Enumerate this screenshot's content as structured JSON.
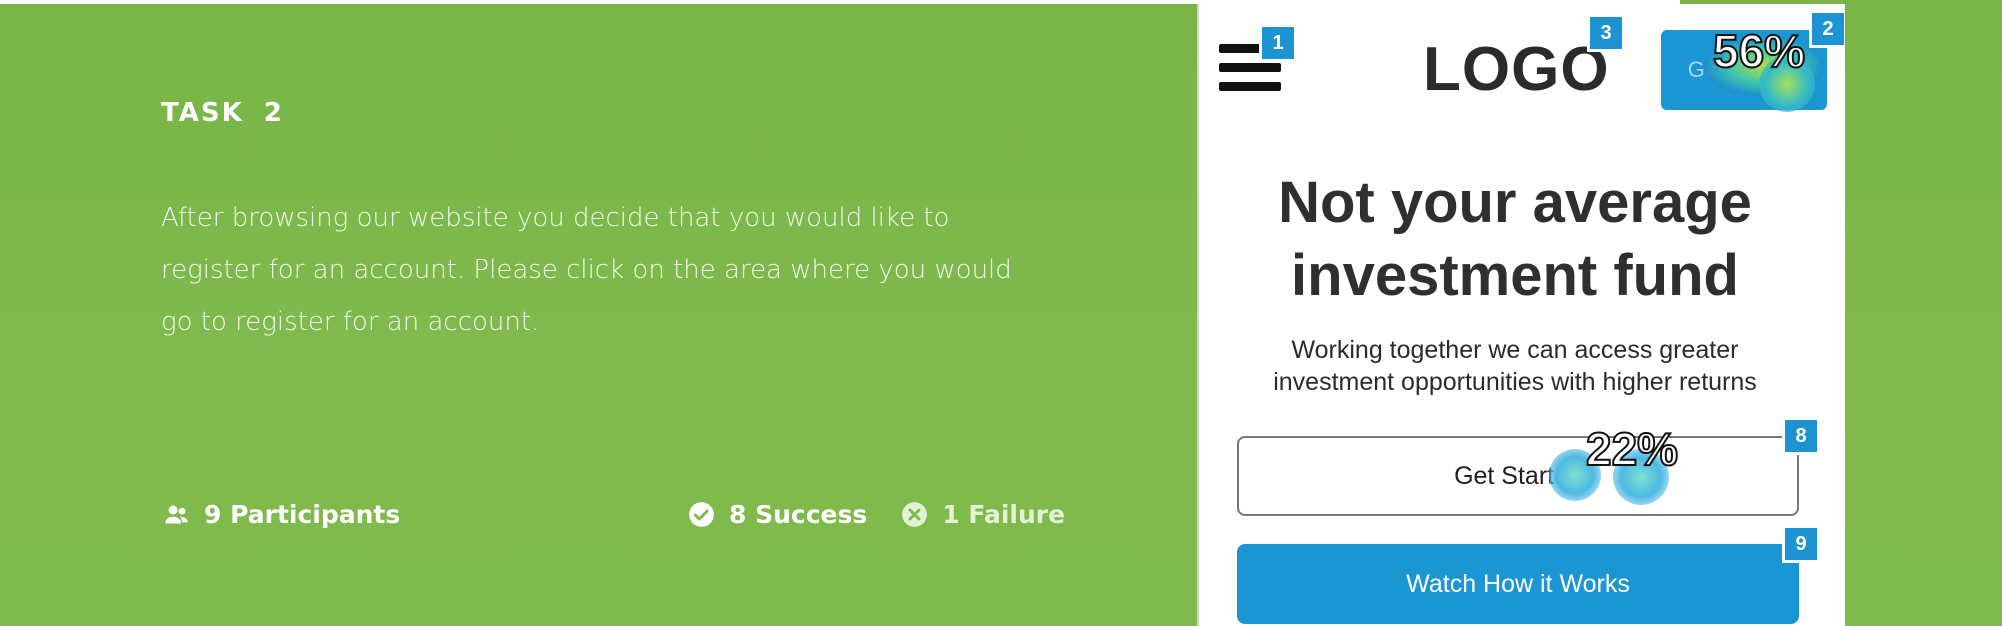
{
  "task": {
    "label": "TASK",
    "number": "2",
    "description": "After browsing our website you decide that you would like to register for an account. Please click on the area where you would go to register for an account."
  },
  "stats": {
    "participants": "9 Participants",
    "success": "8 Success",
    "failure": "1 Failure"
  },
  "preview": {
    "logo": "LOGO",
    "top_cta": "Get Started",
    "headline_line1": "Not your average",
    "headline_line2": "investment fund",
    "subhead_line1": "Working together we can access greater",
    "subhead_line2": "investment opportunities with higher returns",
    "primary_outline": "Get Started",
    "secondary": "Watch How it Works",
    "markers": [
      "1",
      "3",
      "2",
      "8",
      "9"
    ],
    "heatmap_labels": {
      "top_cta": "56%",
      "get_started": "22%"
    }
  },
  "colors": {
    "background": "#7fb94b",
    "accent_blue": "#1a96d2",
    "marker_blue": "#1e93d1",
    "text_dark": "#2f2f2f"
  },
  "icons": [
    "participants-icon",
    "check-circle-icon",
    "x-circle-icon",
    "hamburger-menu-icon"
  ]
}
